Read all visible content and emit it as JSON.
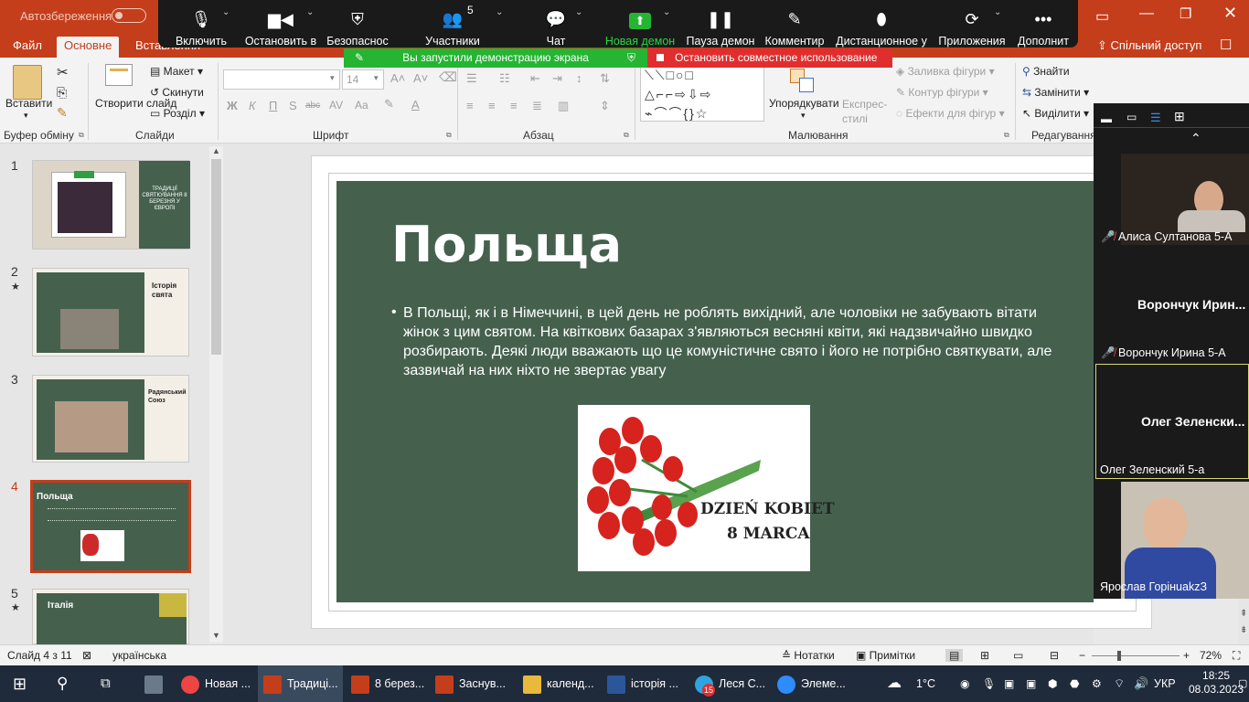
{
  "title_bar": {
    "autosave_label": "Автозбереження",
    "autosave_state": "Вимк."
  },
  "ribbon_tabs": [
    "Файл",
    "Основне",
    "Вставлення"
  ],
  "share_label": "Спільний доступ",
  "zoom_toolbar": {
    "items": [
      {
        "icon": "microphone-icon",
        "label": "Включить"
      },
      {
        "icon": "video-camera-icon",
        "label": "Остановить в"
      },
      {
        "icon": "shield-icon",
        "label": "Безопаснос"
      },
      {
        "icon": "participants-icon",
        "label": "Участники",
        "count": "5"
      },
      {
        "icon": "chat-icon",
        "label": "Чат"
      },
      {
        "icon": "share-screen-icon",
        "label": "Новая демон"
      },
      {
        "icon": "pause-icon",
        "label": "Пауза демон"
      },
      {
        "icon": "pen-icon",
        "label": "Комментир"
      },
      {
        "icon": "mouse-icon",
        "label": "Дистанционное у"
      },
      {
        "icon": "apps-icon",
        "label": "Приложения"
      },
      {
        "icon": "more-icon",
        "label": "Дополнит"
      }
    ],
    "sharing_notice": "Вы запустили демонстрацию экрана",
    "stop_share_label": "Остановить совместное использование",
    "accent_green": "#25b533",
    "accent_red": "#e02e2e"
  },
  "ribbon": {
    "clipboard": {
      "paste_label": "Вставити",
      "group_label": "Буфер обміну"
    },
    "slides": {
      "new_slide_label": "Створити слайд",
      "layout_label": "Макет",
      "reset_label": "Скинути",
      "section_label": "Розділ",
      "group_label": "Слайди"
    },
    "font": {
      "font_name": "",
      "font_size": "14",
      "group_label": "Шрифт"
    },
    "paragraph": {
      "group_label": "Абзац"
    },
    "drawing": {
      "arrange_label": "Упорядкувати",
      "quick_styles_label": "Експрес-стилі",
      "shape_fill_label": "Заливка фігури",
      "shape_outline_label": "Контур фігури",
      "shape_effects_label": "Ефекти для фігур",
      "group_label": "Малювання"
    },
    "editing": {
      "find_label": "Знайти",
      "replace_label": "Замінити",
      "select_label": "Виділити",
      "group_label": "Редагування"
    }
  },
  "thumbnails": [
    {
      "num": "1",
      "title": "ТРАДИЦІЇ СВЯТКУВАННЯ 8 БЕРЕЗНЯ У ЄВРОПІ",
      "starred": false
    },
    {
      "num": "2",
      "title": "Історія свята",
      "starred": true
    },
    {
      "num": "3",
      "title": "Радянський Союз",
      "starred": false
    },
    {
      "num": "4",
      "title": "Польща",
      "starred": false,
      "selected": true
    },
    {
      "num": "5",
      "title": "Італія",
      "starred": true
    }
  ],
  "slide": {
    "title": "Польща",
    "body": "В Польщі, як і в Німеччині, в цей день не роблять вихідний, але чоловіки не забувають вітати жінок з цим святом. На квіткових базарах з'являються весняні квіти, які надзвичайно швидко розбирають. Деякі люди вважають що це комуністичне свято і його не потрібно святкувати, але зазвичай на них ніхто не звертає увагу",
    "image_caption_1": "DZIEŃ KOBIET",
    "image_caption_2": "8 MARCA",
    "background": "#45614e"
  },
  "participants": [
    {
      "label": "Алиса Султанова 5-А",
      "muted": true,
      "video": true
    },
    {
      "label": "Ворончук Ирина 5-А",
      "muted": true,
      "video": false,
      "name_display": "Ворончук Ирин..."
    },
    {
      "label": "Олег Зеленский 5-а",
      "muted": false,
      "video": false,
      "name_display": "Олег Зеленски..."
    },
    {
      "label": "Ярослав ГорінuakzЗ",
      "muted": false,
      "video": true
    }
  ],
  "status_bar": {
    "slide_info": "Слайд 4 з 11",
    "language": "українська",
    "notes_label": "Нотатки",
    "comments_label": "Примітки",
    "zoom": "72%"
  },
  "taskbar": {
    "items": [
      {
        "label": "Новая ..."
      },
      {
        "label": "Традиці..."
      },
      {
        "label": "8 берез..."
      },
      {
        "label": "Заснув..."
      },
      {
        "label": "календ..."
      },
      {
        "label": "історія ..."
      },
      {
        "label": "Леся С..."
      },
      {
        "label": "Элеме..."
      }
    ],
    "weather": "1°C",
    "language": "УКР",
    "time": "18:25",
    "date": "08.03.2023",
    "badge_count": "15"
  }
}
